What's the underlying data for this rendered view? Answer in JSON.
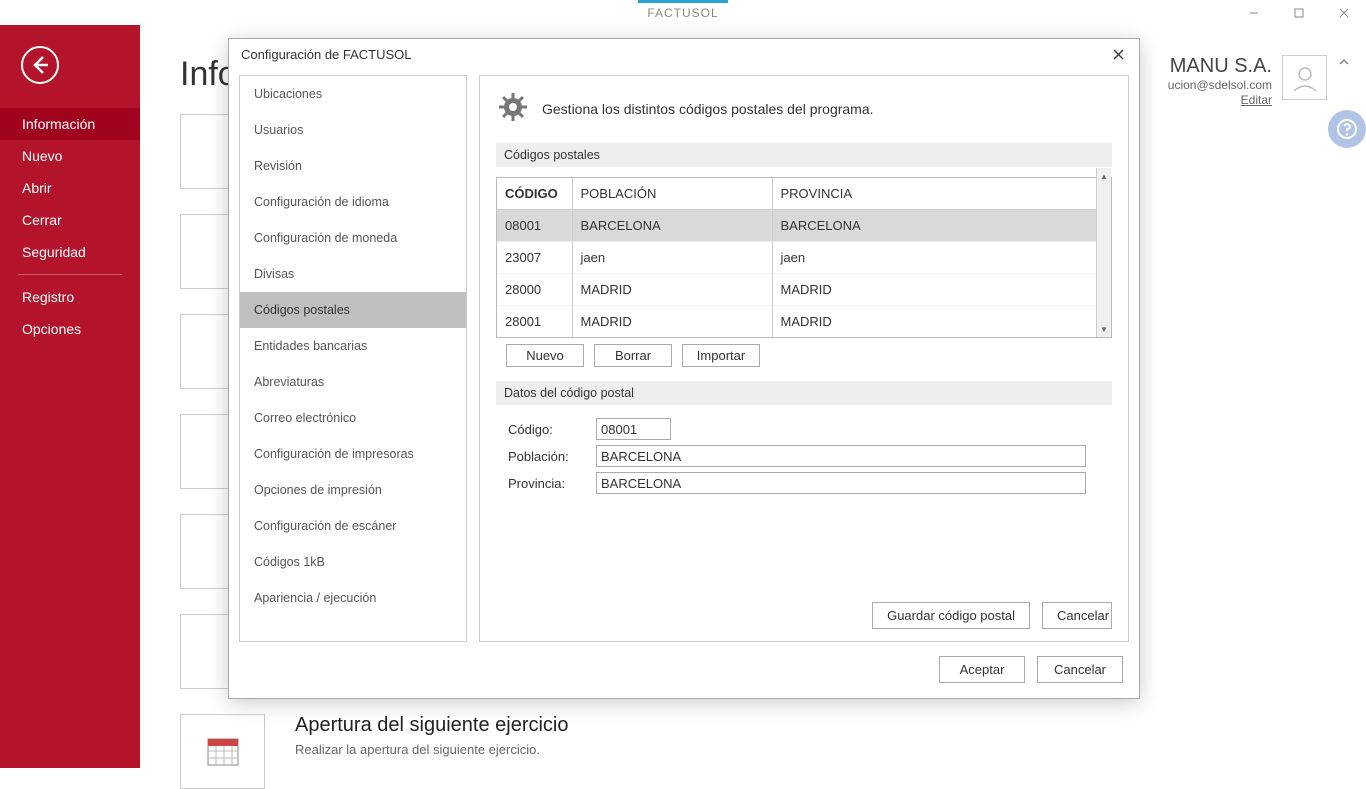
{
  "app_title": "FACTUSOL",
  "backstage": {
    "heading": "Info",
    "items": [
      "Información",
      "Nuevo",
      "Abrir",
      "Cerrar",
      "Seguridad"
    ],
    "items2": [
      "Registro",
      "Opciones"
    ],
    "next_section": {
      "title": "Apertura del siguiente ejercicio",
      "desc": "Realizar la apertura del siguiente ejercicio."
    }
  },
  "account": {
    "name": "MANU S.A.",
    "email": "ucion@sdelsol.com",
    "edit": "Editar"
  },
  "dialog": {
    "title": "Configuración de FACTUSOL",
    "nav": [
      "Ubicaciones",
      "Usuarios",
      "Revisión",
      "Configuración de idioma",
      "Configuración de moneda",
      "Divisas",
      "Códigos postales",
      "Entidades bancarias",
      "Abreviaturas",
      "Correo electrónico",
      "Configuración de impresoras",
      "Opciones de impresión",
      "Configuración de escáner",
      "Códigos 1kB",
      "Apariencia / ejecución"
    ],
    "nav_selected": 6,
    "content": {
      "header": "Gestiona los distintos códigos postales del programa.",
      "grid_title": "Códigos postales",
      "columns": [
        "CÓDIGO",
        "POBLACIÓN",
        "PROVINCIA"
      ],
      "rows": [
        {
          "codigo": "08001",
          "poblacion": "BARCELONA",
          "provincia": "BARCELONA",
          "selected": true
        },
        {
          "codigo": "23007",
          "poblacion": "jaen",
          "provincia": "jaen"
        },
        {
          "codigo": "28000",
          "poblacion": "MADRID",
          "provincia": "MADRID"
        },
        {
          "codigo": "28001",
          "poblacion": "MADRID",
          "provincia": "MADRID"
        }
      ],
      "buttons": {
        "nuevo": "Nuevo",
        "borrar": "Borrar",
        "importar": "Importar"
      },
      "form_title": "Datos del código postal",
      "form": {
        "codigo_label": "Código:",
        "codigo": "08001",
        "poblacion_label": "Población:",
        "poblacion": "BARCELONA",
        "provincia_label": "Provincia:",
        "provincia": "BARCELONA"
      },
      "inner_buttons": {
        "guardar": "Guardar código postal",
        "cancelar": "Cancelar"
      }
    },
    "footer": {
      "aceptar": "Aceptar",
      "cancelar": "Cancelar"
    }
  }
}
